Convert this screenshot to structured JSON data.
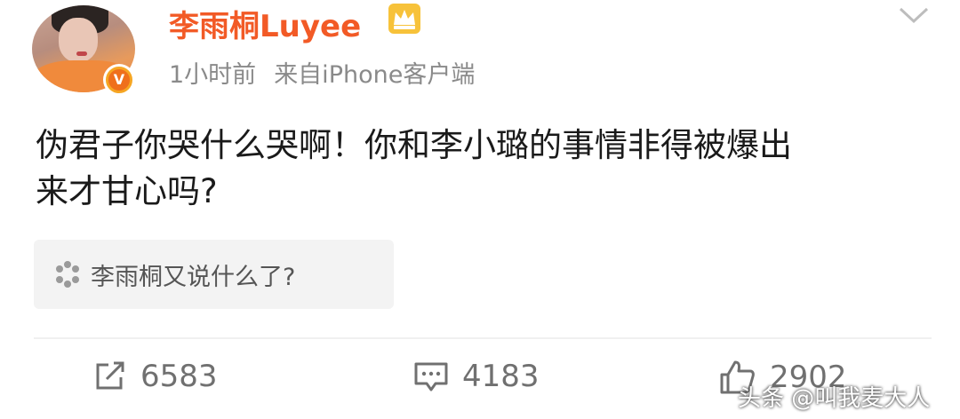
{
  "post": {
    "author": "李雨桐Luyee",
    "time": "1小时前",
    "source": "来自iPhone客户端",
    "text_line1": "伪君子你哭什么哭啊！你和李小璐的事情非得被爆出",
    "text_line2": "来才甘心吗?",
    "topic": "李雨桐又说什么了?",
    "verified_badge": "V"
  },
  "actions": {
    "repost_count": "6583",
    "comment_count": "4183",
    "like_count": "2902"
  },
  "watermark": "头条 @叫我麦大人",
  "icons": {
    "crown": "crown-icon",
    "chevron": "chevron-down-icon",
    "topic": "topic-flower-icon",
    "repost": "repost-icon",
    "comment": "comment-icon",
    "like": "thumbs-up-icon"
  },
  "colors": {
    "author": "#f25a26",
    "badge": "#f6a623",
    "meta": "#8a8a8a"
  }
}
